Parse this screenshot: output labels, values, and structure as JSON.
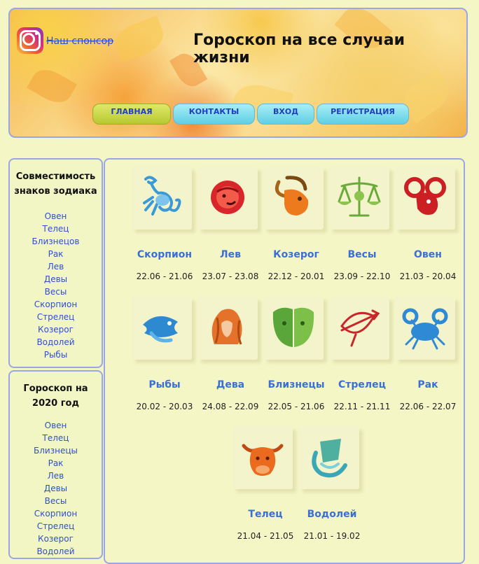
{
  "header": {
    "sponsor_label": "Наш спонсор",
    "site_title": "Гороскоп на все случаи жизни",
    "nav": [
      "ГЛАВНАЯ",
      "КОНТАКТЫ",
      "ВХОД",
      "РЕГИСТРАЦИЯ"
    ]
  },
  "sidebar": {
    "compat_title": "Совместимость знаков зодиака",
    "compat_items": [
      "Овен",
      "Телец",
      "Близнецов",
      "Рак",
      "Лев",
      "Девы",
      "Весы",
      "Скорпион",
      "Стрелец",
      "Козерог",
      "Водолей",
      "Рыбы"
    ],
    "year_title": "Гороскоп на 2020 год",
    "year_items": [
      "Овен",
      "Телец",
      "Близнецы",
      "Рак",
      "Лев",
      "Девы",
      "Весы",
      "Скорпион",
      "Стрелец",
      "Козерог",
      "Водолей"
    ]
  },
  "signs": [
    {
      "name": "Скорпион",
      "dates": "22.06 - 21.06",
      "icon": "scorpio-icon",
      "color": "#3a9ad6"
    },
    {
      "name": "Лев",
      "dates": "23.07 - 23.08",
      "icon": "leo-icon",
      "color": "#d9262a"
    },
    {
      "name": "Козерог",
      "dates": "22.12 - 20.01",
      "icon": "capricorn-icon",
      "color": "#ee7a1e"
    },
    {
      "name": "Весы",
      "dates": "23.09 - 22.10",
      "icon": "libra-icon",
      "color": "#6aaa3a"
    },
    {
      "name": "Овен",
      "dates": "21.03 - 20.04",
      "icon": "aries-icon",
      "color": "#cc1f24"
    },
    {
      "name": "Рыбы",
      "dates": "20.02 - 20.03",
      "icon": "pisces-icon",
      "color": "#2d8ad0"
    },
    {
      "name": "Дева",
      "dates": "24.08 - 22.09",
      "icon": "virgo-icon",
      "color": "#e4722a"
    },
    {
      "name": "Близнецы",
      "dates": "22.05 - 21.06",
      "icon": "gemini-icon",
      "color": "#5aa63a"
    },
    {
      "name": "Стрелец",
      "dates": "22.11 - 21.11",
      "icon": "sagittarius-icon",
      "color": "#c8262a"
    },
    {
      "name": "Рак",
      "dates": "22.06 - 22.07",
      "icon": "cancer-icon",
      "color": "#2f8ad6"
    },
    {
      "name": "Телец",
      "dates": "21.04 - 21.05",
      "icon": "taurus-icon",
      "color": "#ea6a1e"
    },
    {
      "name": "Водолей",
      "dates": "21.01 - 19.02",
      "icon": "aquarius-icon",
      "color": "#3aa6b6"
    }
  ]
}
